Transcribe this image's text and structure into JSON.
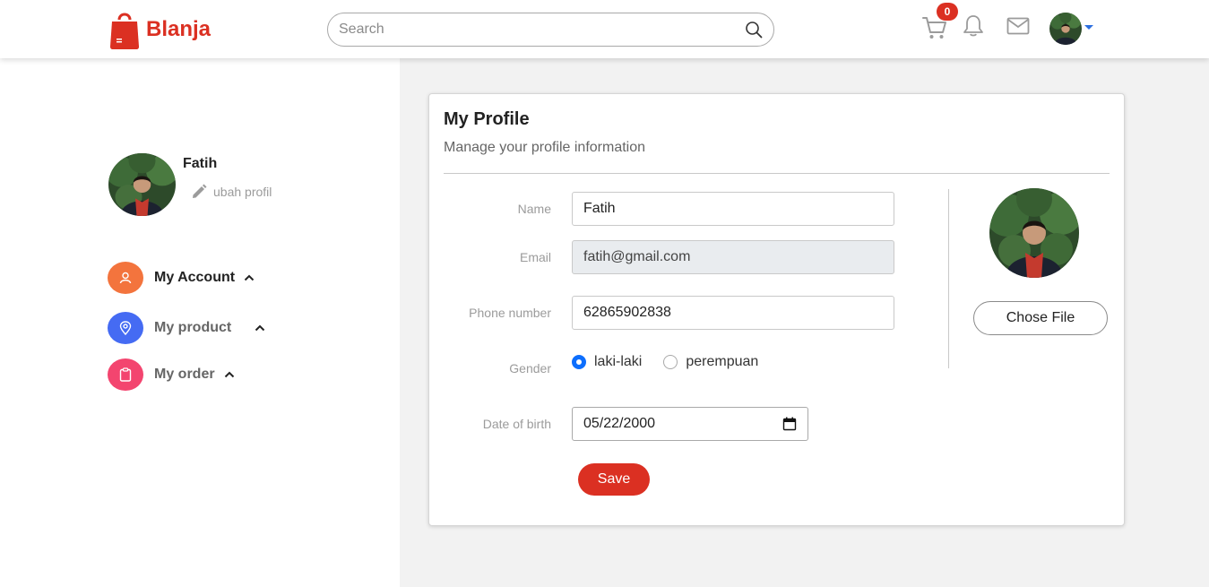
{
  "brand": {
    "name": "Blanja",
    "color": "#db3022"
  },
  "navbar": {
    "search_placeholder": "Search",
    "cart_count": "0",
    "icons": [
      "shopping-bag-icon",
      "search-icon",
      "cart-icon",
      "bell-icon",
      "mail-icon",
      "chevron-down-icon"
    ]
  },
  "sidebar": {
    "user_name": "Fatih",
    "edit_label": "ubah profil",
    "menu": [
      {
        "label": "My Account",
        "icon": "user-icon",
        "color": "#f3743d",
        "text_color": "#222"
      },
      {
        "label": "My product",
        "icon": "map-pin-icon",
        "color": "#456bf3",
        "text_color": "#666"
      },
      {
        "label": "My order",
        "icon": "clipboard-icon",
        "color": "#f3456f",
        "text_color": "#666"
      }
    ]
  },
  "profile": {
    "title": "My Profile",
    "subtitle": "Manage your profile information",
    "fields": {
      "name_label": "Name",
      "name_value": "Fatih",
      "email_label": "Email",
      "email_value": "fatih@gmail.com",
      "phone_label": "Phone number",
      "phone_value": "62865902838",
      "gender_label": "Gender",
      "gender_options": [
        "laki-laki",
        "perempuan"
      ],
      "gender_selected": "laki-laki",
      "dob_label": "Date of birth",
      "dob_value": "05/22/2000"
    },
    "save_label": "Save",
    "choose_file_label": "Chose File"
  }
}
